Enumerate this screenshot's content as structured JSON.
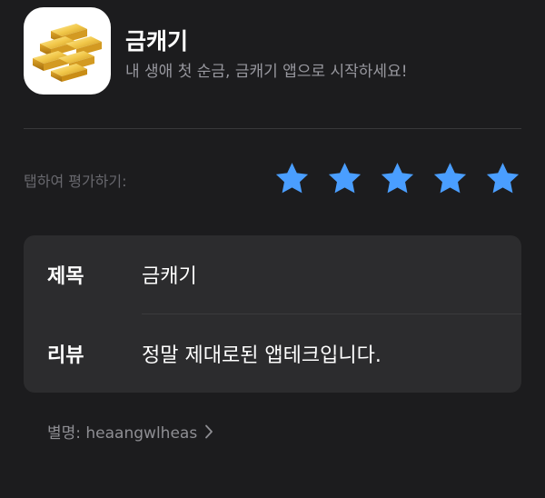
{
  "app": {
    "name": "금캐기",
    "subtitle": "내 생애 첫 순금, 금캐기 앱으로 시작하세요!",
    "icon": "gold-bars-icon"
  },
  "rating": {
    "label": "탭하여 평가하기:",
    "stars_selected": 5,
    "stars_total": 5,
    "star_color": "#4a9eff"
  },
  "review": {
    "title_label": "제목",
    "title_value": "금캐기",
    "body_label": "리뷰",
    "body_value": "정말 제대로된 앱테크입니다."
  },
  "nickname": {
    "text": "별명: heaangwlheas",
    "chevron": "chevron-right-icon"
  },
  "colors": {
    "background": "#1c1c1e",
    "card": "#2c2c2e",
    "accent_gold": "#e2b233"
  }
}
